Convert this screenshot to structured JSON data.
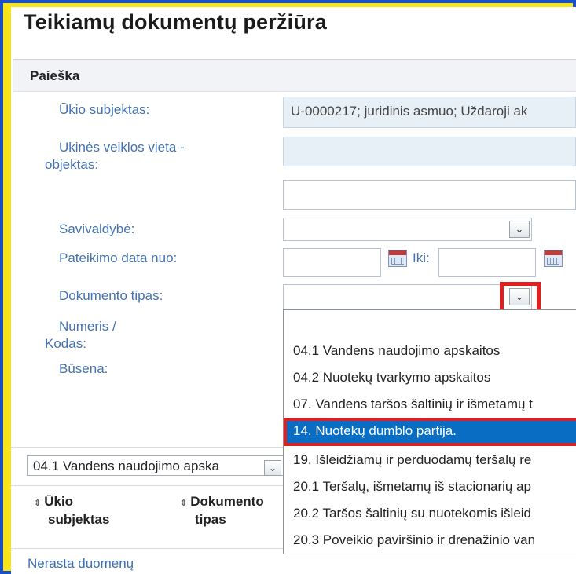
{
  "page": {
    "title": "Teikiamų dokumentų peržiūra"
  },
  "search": {
    "header": "Paieška",
    "labels": {
      "ukio_subjektas": "Ūkio subjektas:",
      "veiklos_vieta_1": "Ūkinės veiklos vieta -",
      "veiklos_vieta_2": "objektas:",
      "savivaldybe": "Savivaldybė:",
      "pateikimo_data": "Pateikimo data nuo:",
      "iki": "Iki:",
      "dokumento_tipas": "Dokumento tipas:",
      "numeris_1": "Numeris /",
      "numeris_2": "Kodas:",
      "busena": "Būsena:"
    },
    "ukio_subjektas_value": "U-0000217; juridinis asmuo; Uždaroji ak",
    "dokumento_tipas_options": [
      "04.1 Vandens naudojimo apskaitos",
      "04.2 Nuotekų tvarkymo apskaitos",
      "07. Vandens taršos šaltinių ir išmetamų t",
      "14. Nuotekų dumblo partija.",
      "19. Išleidžiamų ir perduodamų teršalų re",
      "20.1 Teršalų, išmetamų iš stacionarių ap",
      "20.2 Taršos šaltinių su nuotekomis išleid",
      "20.3 Poveikio paviršinio ir drenažinio van"
    ],
    "selected_option": "14. Nuotekų dumblo partija."
  },
  "results": {
    "filter_value": "04.1 Vandens naudojimo apska",
    "columns": [
      {
        "line1": "Ūkio",
        "line2": "subjektas"
      },
      {
        "line1": "Dokumento",
        "line2": "tipas"
      }
    ],
    "empty_text": "Nerasta duomenų"
  },
  "colors": {
    "highlight": "#0a6dc4",
    "annotation": "#e0201e",
    "frame_outer": "#1a4fc8",
    "frame_inner": "#f7e41c"
  }
}
